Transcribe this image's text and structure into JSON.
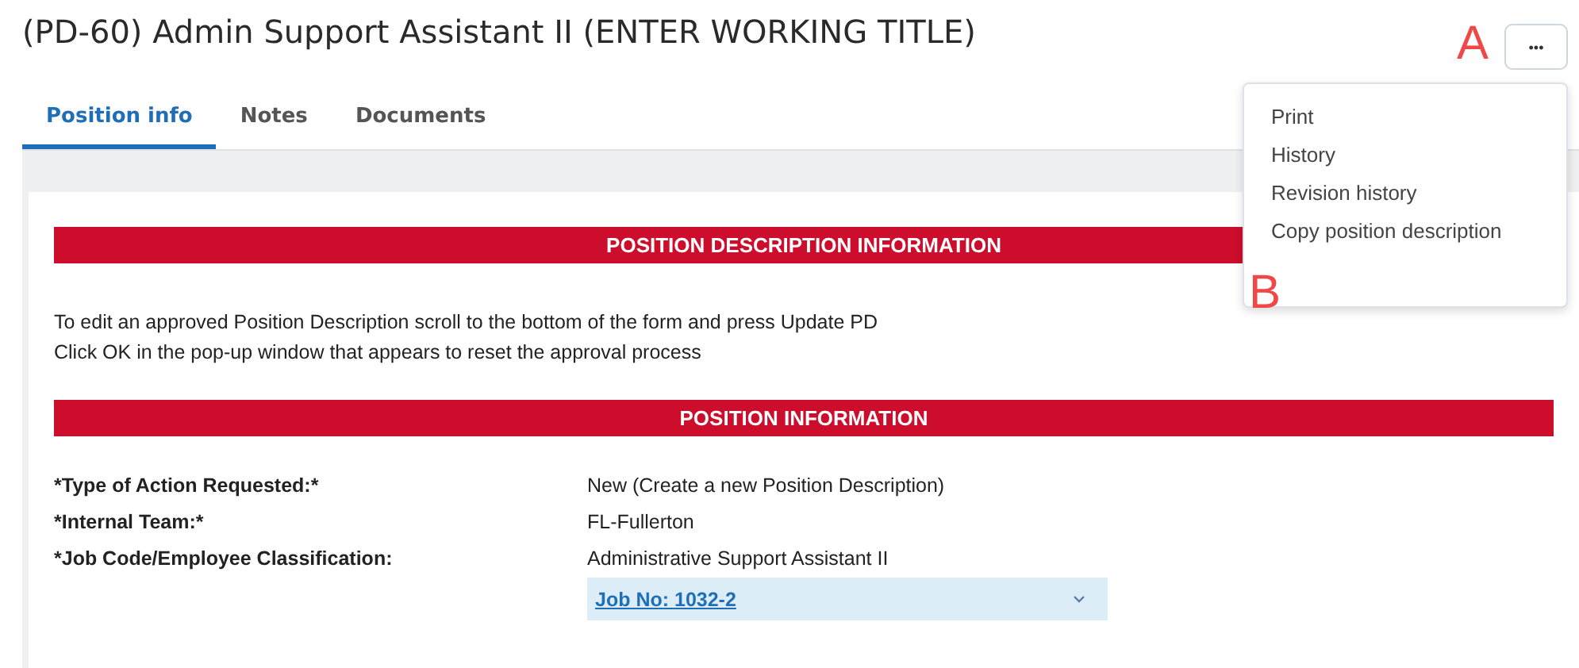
{
  "title": "(PD-60) Admin Support Assistant II (ENTER WORKING TITLE)",
  "more_button": {
    "label": "•••"
  },
  "annotations": [
    {
      "label": "A"
    },
    {
      "label": "B"
    }
  ],
  "tabs": [
    {
      "label": "Position info",
      "selected": true
    },
    {
      "label": "Notes",
      "selected": false
    },
    {
      "label": "Documents",
      "selected": false
    }
  ],
  "menu": {
    "items": [
      "Print",
      "History",
      "Revision history",
      "Copy position description"
    ]
  },
  "sections": [
    {
      "heading": "POSITION DESCRIPTION INFORMATION",
      "notes": [
        "To edit an approved Position Description scroll to the bottom of the form and press Update PD",
        "Click OK in the pop-up window that appears to reset the approval process"
      ]
    },
    {
      "heading": "POSITION INFORMATION",
      "fields": [
        {
          "label": "*Type of Action Requested:*",
          "value": "New (Create a new Position Description)"
        },
        {
          "label": "*Internal Team:*",
          "value": "FL-Fullerton"
        },
        {
          "label": "*Job Code/Employee Classification:",
          "value": "Administrative Support Assistant II",
          "link": "Job No: 1032-2"
        }
      ]
    }
  ]
}
